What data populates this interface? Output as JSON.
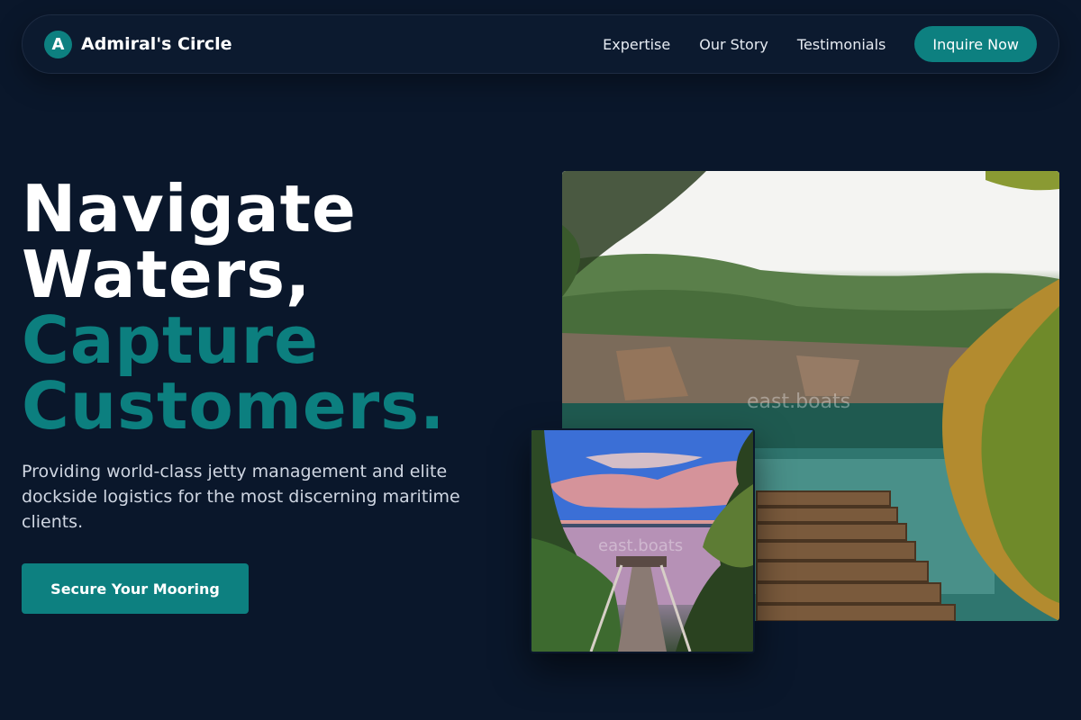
{
  "nav": {
    "brand_mark": "A",
    "brand_name": "Admiral's Circle",
    "links": [
      "Expertise",
      "Our Story",
      "Testimonials"
    ],
    "cta_label": "Inquire Now"
  },
  "hero": {
    "title_line1": "Navigate",
    "title_line2": "Waters,",
    "title_line3": "Capture",
    "title_line4": "Customers.",
    "subtitle": "Providing world-class jetty management and elite dockside logistics for the most discerning maritime clients.",
    "cta_label": "Secure Your Mooring"
  },
  "images": {
    "large_watermark": "east.boats",
    "small_watermark": "east.boats"
  },
  "colors": {
    "background": "#0a172b",
    "accent": "#0d8080",
    "accent_text": "#0c7f7f"
  }
}
